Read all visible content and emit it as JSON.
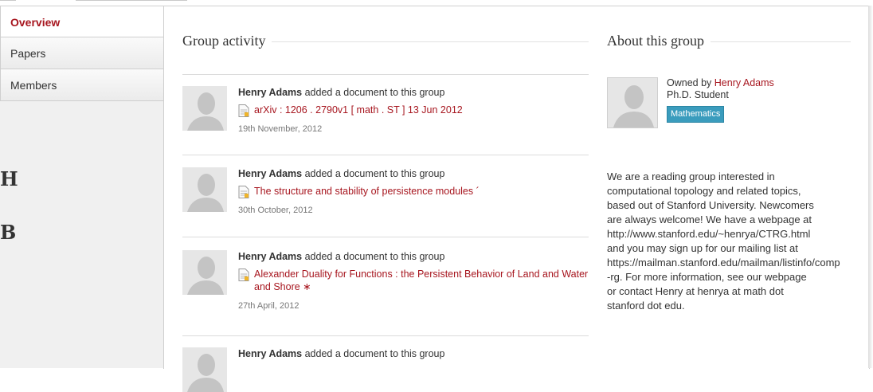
{
  "nav": {
    "items": [
      {
        "label": "Overview",
        "active": true
      },
      {
        "label": "Papers",
        "active": false
      },
      {
        "label": "Members",
        "active": false
      }
    ],
    "cut_letters": [
      "H",
      "B"
    ]
  },
  "activity": {
    "title": "Group activity",
    "items": [
      {
        "user": "Henry Adams",
        "action": "added a document to this group",
        "doc": "arXiv : 1206 . 2790v1 [ math . ST ] 13 Jun 2012",
        "date": "19th November, 2012"
      },
      {
        "user": "Henry Adams",
        "action": "added a document to this group",
        "doc": "The structure and stability of persistence modules ´",
        "date": "30th October, 2012"
      },
      {
        "user": "Henry Adams",
        "action": "added a document to this group",
        "doc": "Alexander Duality for Functions : the Persistent Behavior of Land and Water and Shore ∗",
        "date": "27th April, 2012"
      },
      {
        "user": "Henry Adams",
        "action": "added a document to this group",
        "doc": "",
        "date": ""
      }
    ]
  },
  "about": {
    "title": "About this group",
    "owned_by_label": "Owned by",
    "owner": "Henry Adams",
    "owner_role": "Ph.D. Student",
    "tag": "Mathematics",
    "description": "We are a reading group interested in\ncomputational topology and related topics,\nbased out of Stanford University. Newcomers\nare always welcome! We have a webpage at\nhttp://www.stanford.edu/~henrya/CTRG.html\nand you may sign up for our mailing list at\nhttps://mailman.stanford.edu/mailman/listinfo/comp\n-rg. For more information, see our webpage\nor contact Henry at henrya at math dot\nstanford dot edu."
  },
  "colors": {
    "accent": "#a7161f",
    "tag": "#3a9cbd"
  }
}
